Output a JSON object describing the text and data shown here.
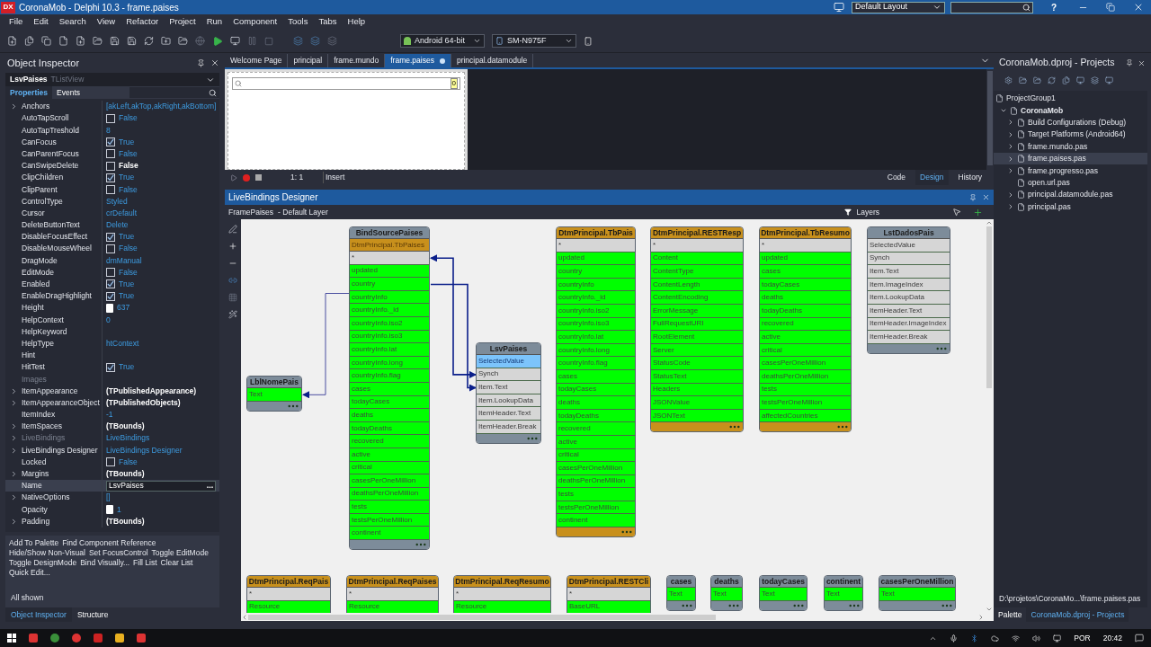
{
  "window": {
    "logo": "DX",
    "title": "CoronaMob - Delphi 10.3 - frame.paises",
    "layout": "Default Layout",
    "help": "?"
  },
  "menu": [
    "File",
    "Edit",
    "Search",
    "View",
    "Refactor",
    "Project",
    "Run",
    "Component",
    "Tools",
    "Tabs",
    "Help"
  ],
  "toolbar": {
    "platform": "Android 64-bit",
    "device": "SM-N975F"
  },
  "object_inspector": {
    "title": "Object Inspector",
    "component": "LsvPaises",
    "component_type": "TListView",
    "tabs": [
      {
        "label": "Properties",
        "selected": true
      },
      {
        "label": "Events",
        "selected": false
      }
    ],
    "properties": [
      {
        "name": "Anchors",
        "value": "[akLeft,akTop,akRight,akBottom]",
        "kind": "text",
        "expandable": true,
        "dimmed": false
      },
      {
        "name": "AutoTapScroll",
        "value": "False",
        "kind": "check",
        "checked": false,
        "expandable": false,
        "dimmed": false
      },
      {
        "name": "AutoTapTreshold",
        "value": "8",
        "kind": "text",
        "expandable": false,
        "dimmed": false
      },
      {
        "name": "CanFocus",
        "value": "True",
        "kind": "check",
        "checked": true,
        "expandable": false,
        "dimmed": false
      },
      {
        "name": "CanParentFocus",
        "value": "False",
        "kind": "check",
        "checked": false,
        "expandable": false,
        "dimmed": false
      },
      {
        "name": "CanSwipeDelete",
        "value": "False",
        "kind": "check_bold",
        "checked": false,
        "expandable": false,
        "dimmed": false
      },
      {
        "name": "ClipChildren",
        "value": "True",
        "kind": "check",
        "checked": true,
        "expandable": false,
        "dimmed": false
      },
      {
        "name": "ClipParent",
        "value": "False",
        "kind": "check",
        "checked": false,
        "expandable": false,
        "dimmed": false
      },
      {
        "name": "ControlType",
        "value": "Styled",
        "kind": "text",
        "expandable": false,
        "dimmed": false
      },
      {
        "name": "Cursor",
        "value": "crDefault",
        "kind": "text",
        "expandable": false,
        "dimmed": false
      },
      {
        "name": "DeleteButtonText",
        "value": "Delete",
        "kind": "text",
        "expandable": false,
        "dimmed": false
      },
      {
        "name": "DisableFocusEffect",
        "value": "True",
        "kind": "check",
        "checked": true,
        "expandable": false,
        "dimmed": false
      },
      {
        "name": "DisableMouseWheel",
        "value": "False",
        "kind": "check",
        "checked": false,
        "expandable": false,
        "dimmed": false
      },
      {
        "name": "DragMode",
        "value": "dmManual",
        "kind": "text",
        "expandable": false,
        "dimmed": false
      },
      {
        "name": "EditMode",
        "value": "False",
        "kind": "check",
        "checked": false,
        "expandable": false,
        "dimmed": false
      },
      {
        "name": "Enabled",
        "value": "True",
        "kind": "check",
        "checked": true,
        "expandable": false,
        "dimmed": false
      },
      {
        "name": "EnableDragHighlight",
        "value": "True",
        "kind": "check",
        "checked": true,
        "expandable": false,
        "dimmed": false
      },
      {
        "name": "Height",
        "value": "637",
        "kind": "number",
        "expandable": false,
        "dimmed": false
      },
      {
        "name": "HelpContext",
        "value": "0",
        "kind": "text",
        "expandable": false,
        "dimmed": false
      },
      {
        "name": "HelpKeyword",
        "kind": "text",
        "expandable": false,
        "dimmed": false
      },
      {
        "name": "HelpType",
        "value": "htContext",
        "kind": "text",
        "expandable": false,
        "dimmed": false
      },
      {
        "name": "Hint",
        "kind": "text",
        "expandable": false,
        "dimmed": false
      },
      {
        "name": "HitTest",
        "value": "True",
        "kind": "check",
        "checked": true,
        "expandable": false,
        "dimmed": false
      },
      {
        "name": "Images",
        "kind": "text",
        "expandable": false,
        "dimmed": true
      },
      {
        "name": "ItemAppearance",
        "value": "(TPublishedAppearance)",
        "kind": "bold",
        "expandable": true,
        "dimmed": false
      },
      {
        "name": "ItemAppearanceObject",
        "value": "(TPublishedObjects)",
        "kind": "bold",
        "expandable": true,
        "dimmed": false
      },
      {
        "name": "ItemIndex",
        "value": "-1",
        "kind": "text",
        "expandable": false,
        "dimmed": false
      },
      {
        "name": "ItemSpaces",
        "value": "(TBounds)",
        "kind": "bold",
        "expandable": true,
        "dimmed": false
      },
      {
        "name": "LiveBindings",
        "value": "LiveBindings",
        "kind": "text",
        "expandable": true,
        "dimmed": true
      },
      {
        "name": "LiveBindings Designer",
        "value": "LiveBindings Designer",
        "kind": "text",
        "expandable": true,
        "dimmed": false
      },
      {
        "name": "Locked",
        "value": "False",
        "kind": "check",
        "checked": false,
        "expandable": false,
        "dimmed": false
      },
      {
        "name": "Margins",
        "value": "(TBounds)",
        "kind": "bold",
        "expandable": true,
        "dimmed": false
      },
      {
        "name": "Name",
        "value": "LsvPaises",
        "kind": "edit",
        "button": "...",
        "expandable": false,
        "dimmed": false
      },
      {
        "name": "NativeOptions",
        "value": "[]",
        "kind": "text",
        "expandable": true,
        "dimmed": false
      },
      {
        "name": "Opacity",
        "value": "1",
        "kind": "number",
        "expandable": false,
        "dimmed": false
      },
      {
        "name": "Padding",
        "value": "(TBounds)",
        "kind": "bold",
        "expandable": true,
        "dimmed": false
      }
    ],
    "actions": [
      "Add To Palette",
      "Find Component Reference",
      "Hide/Show Non-Visual",
      "Set FocusControl",
      "Toggle EditMode",
      "Toggle DesignMode",
      "Bind Visually...",
      "Fill List",
      "Clear List",
      "Quick Edit..."
    ],
    "filter_status": "All shown",
    "bottom_tabs": [
      {
        "label": "Object Inspector",
        "selected": true
      },
      {
        "label": "Structure",
        "selected": false
      }
    ]
  },
  "editor": {
    "tabs": [
      {
        "label": "Welcome Page",
        "selected": false,
        "modified": false
      },
      {
        "label": "principal",
        "selected": false,
        "modified": false
      },
      {
        "label": "frame.mundo",
        "selected": false,
        "modified": false
      },
      {
        "label": "frame.paises",
        "selected": true,
        "modified": true
      },
      {
        "label": "principal.datamodule",
        "selected": false,
        "modified": false
      }
    ],
    "form_badge": "0",
    "status": {
      "position": "1: 1",
      "mode": "Insert"
    },
    "view_tabs": [
      {
        "label": "Code",
        "selected": false
      },
      {
        "label": "Design",
        "selected": true
      },
      {
        "label": "History",
        "selected": false
      }
    ]
  },
  "livebindings": {
    "title": "LiveBindings Designer",
    "breadcrumb": [
      "FramePaises",
      "- Default Layer"
    ],
    "layers": "Layers",
    "nodes": [
      {
        "title": "LblNomePais",
        "kind": "component",
        "rows": [
          {
            "text": "Text",
            "kind": "field"
          }
        ]
      },
      {
        "title": "BindSourcePaises",
        "kind": "component",
        "subtitle": "DtmPrincipal.TbPaises",
        "rows": [
          {
            "text": "*",
            "kind": "member"
          },
          {
            "text": "updated",
            "kind": "field"
          },
          {
            "text": "country",
            "kind": "field"
          },
          {
            "text": "countryInfo",
            "kind": "field"
          },
          {
            "text": "countryInfo._id",
            "kind": "field"
          },
          {
            "text": "countryInfo.iso2",
            "kind": "field"
          },
          {
            "text": "countryInfo.iso3",
            "kind": "field"
          },
          {
            "text": "countryInfo.lat",
            "kind": "field"
          },
          {
            "text": "countryInfo.long",
            "kind": "field"
          },
          {
            "text": "countryInfo.flag",
            "kind": "field"
          },
          {
            "text": "cases",
            "kind": "field"
          },
          {
            "text": "todayCases",
            "kind": "field"
          },
          {
            "text": "deaths",
            "kind": "field"
          },
          {
            "text": "todayDeaths",
            "kind": "field"
          },
          {
            "text": "recovered",
            "kind": "field"
          },
          {
            "text": "active",
            "kind": "field"
          },
          {
            "text": "critical",
            "kind": "field"
          },
          {
            "text": "casesPerOneMillion",
            "kind": "field"
          },
          {
            "text": "deathsPerOneMillion",
            "kind": "field"
          },
          {
            "text": "tests",
            "kind": "field"
          },
          {
            "text": "testsPerOneMillion",
            "kind": "field"
          },
          {
            "text": "continent",
            "kind": "field"
          }
        ]
      },
      {
        "title": "LsvPaises",
        "kind": "component",
        "rows": [
          {
            "text": "SelectedValue",
            "kind": "highlighted"
          },
          {
            "text": "Synch",
            "kind": "member"
          },
          {
            "text": "Item.Text",
            "kind": "member"
          },
          {
            "text": "Item.LookupData",
            "kind": "member"
          },
          {
            "text": "ItemHeader.Text",
            "kind": "member"
          },
          {
            "text": "ItemHeader.Break",
            "kind": "member"
          }
        ]
      },
      {
        "title": "DtmPrincipal.TbPais",
        "kind": "dataset",
        "rows": [
          {
            "text": "*",
            "kind": "member"
          },
          {
            "text": "updated",
            "kind": "field"
          },
          {
            "text": "country",
            "kind": "field"
          },
          {
            "text": "countryInfo",
            "kind": "field"
          },
          {
            "text": "countryInfo._id",
            "kind": "field"
          },
          {
            "text": "countryInfo.iso2",
            "kind": "field"
          },
          {
            "text": "countryInfo.iso3",
            "kind": "field"
          },
          {
            "text": "countryInfo.lat",
            "kind": "field"
          },
          {
            "text": "countryInfo.long",
            "kind": "field"
          },
          {
            "text": "countryInfo.flag",
            "kind": "field"
          },
          {
            "text": "cases",
            "kind": "field"
          },
          {
            "text": "todayCases",
            "kind": "field"
          },
          {
            "text": "deaths",
            "kind": "field"
          },
          {
            "text": "todayDeaths",
            "kind": "field"
          },
          {
            "text": "recovered",
            "kind": "field"
          },
          {
            "text": "active",
            "kind": "field"
          },
          {
            "text": "critical",
            "kind": "field"
          },
          {
            "text": "casesPerOneMillion",
            "kind": "field"
          },
          {
            "text": "deathsPerOneMillion",
            "kind": "field"
          },
          {
            "text": "tests",
            "kind": "field"
          },
          {
            "text": "testsPerOneMillion",
            "kind": "field"
          },
          {
            "text": "continent",
            "kind": "field"
          }
        ]
      },
      {
        "title": "DtmPrincipal.RESTResp",
        "kind": "dataset",
        "rows": [
          {
            "text": "*",
            "kind": "member"
          },
          {
            "text": "Content",
            "kind": "field"
          },
          {
            "text": "ContentType",
            "kind": "field"
          },
          {
            "text": "ContentLength",
            "kind": "field"
          },
          {
            "text": "ContentEncoding",
            "kind": "field"
          },
          {
            "text": "ErrorMessage",
            "kind": "field"
          },
          {
            "text": "FullRequestURI",
            "kind": "field"
          },
          {
            "text": "RootElement",
            "kind": "field"
          },
          {
            "text": "Server",
            "kind": "field"
          },
          {
            "text": "StatusCode",
            "kind": "field"
          },
          {
            "text": "StatusText",
            "kind": "field"
          },
          {
            "text": "Headers",
            "kind": "field"
          },
          {
            "text": "JSONValue",
            "kind": "field"
          },
          {
            "text": "JSONText",
            "kind": "field"
          }
        ]
      },
      {
        "title": "DtmPrincipal.TbResumo",
        "kind": "dataset",
        "rows": [
          {
            "text": "*",
            "kind": "member"
          },
          {
            "text": "updated",
            "kind": "field"
          },
          {
            "text": "cases",
            "kind": "field"
          },
          {
            "text": "todayCases",
            "kind": "field"
          },
          {
            "text": "deaths",
            "kind": "field"
          },
          {
            "text": "todayDeaths",
            "kind": "field"
          },
          {
            "text": "recovered",
            "kind": "field"
          },
          {
            "text": "active",
            "kind": "field"
          },
          {
            "text": "critical",
            "kind": "field"
          },
          {
            "text": "casesPerOneMillion",
            "kind": "field"
          },
          {
            "text": "deathsPerOneMillion",
            "kind": "field"
          },
          {
            "text": "tests",
            "kind": "field"
          },
          {
            "text": "testsPerOneMillion",
            "kind": "field"
          },
          {
            "text": "affectedCountries",
            "kind": "field"
          }
        ]
      },
      {
        "title": "LstDadosPais",
        "kind": "component",
        "rows": [
          {
            "text": "SelectedValue",
            "kind": "member"
          },
          {
            "text": "Synch",
            "kind": "member"
          },
          {
            "text": "Item.Text",
            "kind": "member"
          },
          {
            "text": "Item.ImageIndex",
            "kind": "member"
          },
          {
            "text": "Item.LookupData",
            "kind": "member"
          },
          {
            "text": "ItemHeader.Text",
            "kind": "member"
          },
          {
            "text": "ItemHeader.ImageIndex",
            "kind": "member"
          },
          {
            "text": "ItemHeader.Break",
            "kind": "member"
          }
        ]
      },
      {
        "title": "DtmPrincipal.ReqPais",
        "kind": "dataset",
        "rows": [
          {
            "text": "*",
            "kind": "member"
          },
          {
            "text": "Resource",
            "kind": "field"
          }
        ]
      },
      {
        "title": "DtmPrincipal.ReqPaises",
        "kind": "dataset",
        "rows": [
          {
            "text": "*",
            "kind": "member"
          },
          {
            "text": "Resource",
            "kind": "field"
          }
        ]
      },
      {
        "title": "DtmPrincipal.ReqResumo",
        "kind": "dataset",
        "rows": [
          {
            "text": "*",
            "kind": "member"
          },
          {
            "text": "Resource",
            "kind": "field"
          }
        ]
      },
      {
        "title": "DtmPrincipal.RESTCli",
        "kind": "dataset",
        "rows": [
          {
            "text": "*",
            "kind": "member"
          },
          {
            "text": "BaseURL",
            "kind": "field"
          }
        ]
      },
      {
        "title": "cases",
        "kind": "component",
        "rows": [
          {
            "text": "Text",
            "kind": "field"
          }
        ]
      },
      {
        "title": "deaths",
        "kind": "component",
        "rows": [
          {
            "text": "Text",
            "kind": "field"
          }
        ]
      },
      {
        "title": "todayCases",
        "kind": "component",
        "rows": [
          {
            "text": "Text",
            "kind": "field"
          }
        ]
      },
      {
        "title": "continent",
        "kind": "component",
        "rows": [
          {
            "text": "Text",
            "kind": "field"
          }
        ]
      },
      {
        "title": "casesPerOneMillion",
        "kind": "component",
        "rows": [
          {
            "text": "Text",
            "kind": "field"
          }
        ]
      }
    ]
  },
  "projects": {
    "title": "CoronaMob.dproj - Projects",
    "tree": [
      {
        "label": "ProjectGroup1",
        "selected": false,
        "children": [
          {
            "label": "CoronaMob",
            "expanded": true,
            "selected": false,
            "children": [
              {
                "label": "Build Configurations (Debug)",
                "expanded": false,
                "selected": false
              },
              {
                "label": "Target Platforms (Android64)",
                "expanded": false,
                "selected": false
              },
              {
                "label": "frame.mundo.pas",
                "expanded": false,
                "selected": false
              },
              {
                "label": "frame.paises.pas",
                "expanded": false,
                "selected": true
              },
              {
                "label": "frame.progresso.pas",
                "expanded": false,
                "selected": false
              },
              {
                "label": "open.url.pas",
                "selected": false
              },
              {
                "label": "principal.datamodule.pas",
                "expanded": false,
                "selected": false
              },
              {
                "label": "principal.pas",
                "expanded": false,
                "selected": false
              }
            ]
          }
        ]
      }
    ],
    "path": "D:\\projetos\\CoronaMo...\\frame.paises.pas",
    "bottom_tabs": [
      {
        "label": "Palette",
        "selected": false
      },
      {
        "label": "CoronaMob.dproj - Projects",
        "selected": true
      }
    ]
  },
  "taskbar": {
    "language": "POR",
    "time": "20:42"
  }
}
